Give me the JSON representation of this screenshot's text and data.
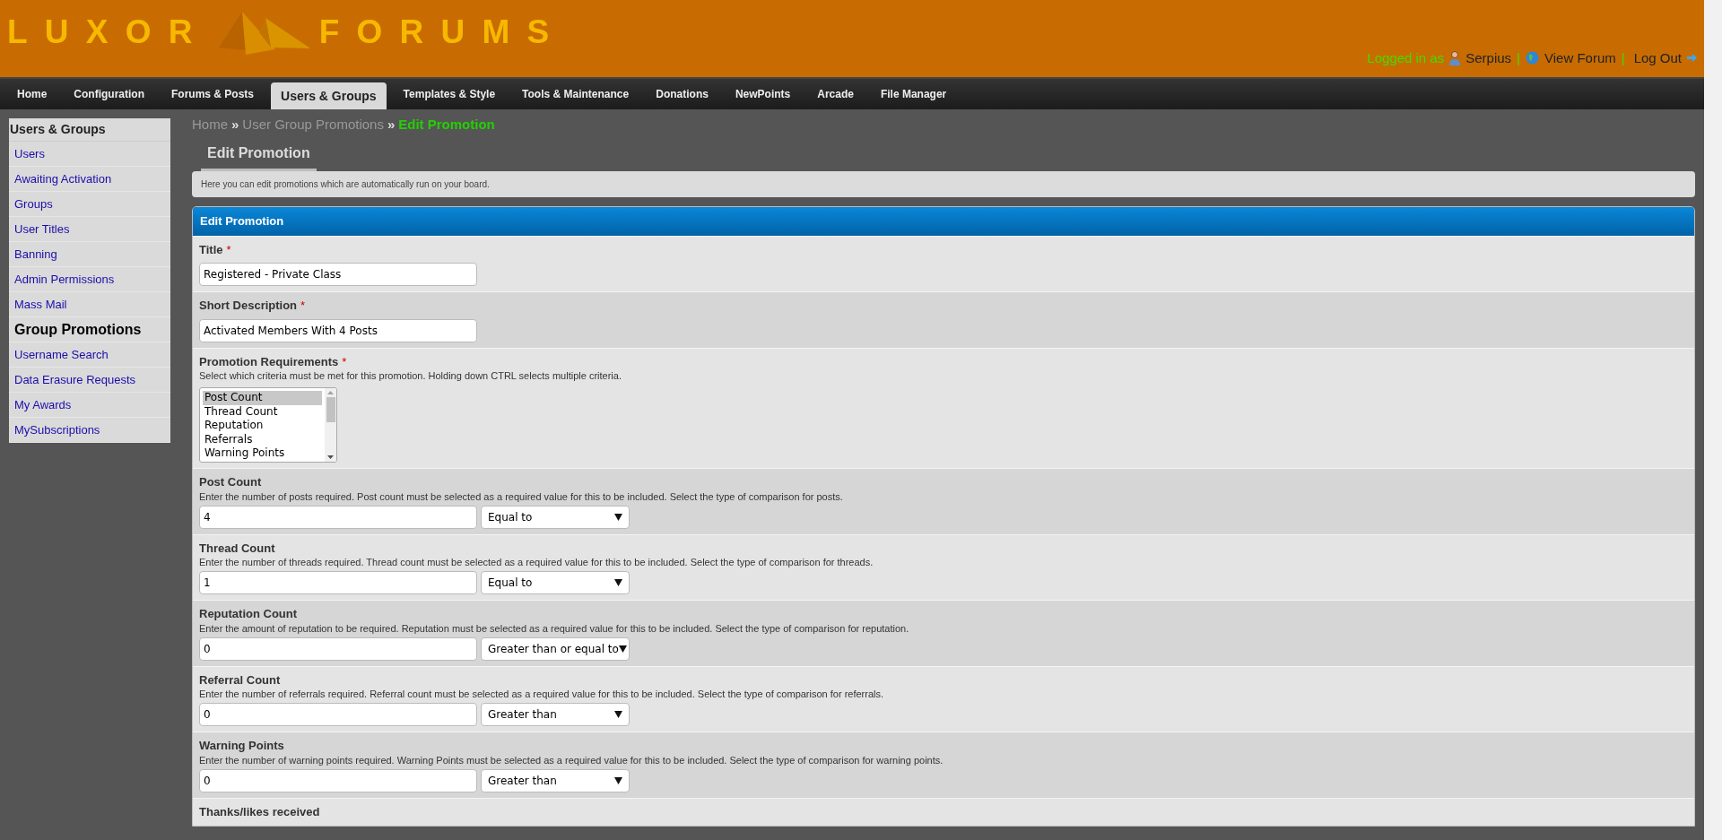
{
  "logo": {
    "left": "LUXOR",
    "right": "FORUMS"
  },
  "user_bar": {
    "logged_in_label": "Logged in as",
    "username": "Serpius",
    "view_forum": "View Forum",
    "log_out": "Log Out",
    "separator": "|"
  },
  "nav_tabs": [
    {
      "label": "Home",
      "selected": false
    },
    {
      "label": "Configuration",
      "selected": false
    },
    {
      "label": "Forums & Posts",
      "selected": false
    },
    {
      "label": "Users & Groups",
      "selected": true
    },
    {
      "label": "Templates & Style",
      "selected": false
    },
    {
      "label": "Tools & Maintenance",
      "selected": false
    },
    {
      "label": "Donations",
      "selected": false
    },
    {
      "label": "NewPoints",
      "selected": false
    },
    {
      "label": "Arcade",
      "selected": false
    },
    {
      "label": "File Manager",
      "selected": false
    }
  ],
  "sidebar": {
    "title": "Users & Groups",
    "items": [
      {
        "label": "Users",
        "selected": false
      },
      {
        "label": "Awaiting Activation",
        "selected": false
      },
      {
        "label": "Groups",
        "selected": false
      },
      {
        "label": "User Titles",
        "selected": false
      },
      {
        "label": "Banning",
        "selected": false
      },
      {
        "label": "Admin Permissions",
        "selected": false
      },
      {
        "label": "Mass Mail",
        "selected": false
      },
      {
        "label": "Group Promotions",
        "selected": true
      },
      {
        "label": "Username Search",
        "selected": false
      },
      {
        "label": "Data Erasure Requests",
        "selected": false
      },
      {
        "label": "My Awards",
        "selected": false
      },
      {
        "label": "MySubscriptions",
        "selected": false
      }
    ]
  },
  "breadcrumb": {
    "items": [
      "Home",
      "User Group Promotions",
      "Edit Promotion"
    ],
    "separator": "»"
  },
  "page_tab": "Edit Promotion",
  "page_description": "Here you can edit promotions which are automatically run on your board.",
  "form": {
    "title": "Edit Promotion",
    "required_mark": "*",
    "rows": [
      {
        "kind": "text",
        "label": "Title",
        "required": true,
        "value": "Registered - Private Class"
      },
      {
        "kind": "text",
        "label": "Short Description",
        "required": true,
        "value": "Activated Members With 4 Posts"
      },
      {
        "kind": "listbox",
        "label": "Promotion Requirements",
        "required": true,
        "description": "Select which criteria must be met for this promotion. Holding down CTRL selects multiple criteria.",
        "options": [
          {
            "label": "Post Count",
            "selected": true
          },
          {
            "label": "Thread Count",
            "selected": false
          },
          {
            "label": "Reputation",
            "selected": false
          },
          {
            "label": "Referrals",
            "selected": false
          },
          {
            "label": "Warning Points",
            "selected": false
          }
        ]
      },
      {
        "kind": "compare",
        "label": "Post Count",
        "required": false,
        "description": "Enter the number of posts required. Post count must be selected as a required value for this to be included. Select the type of comparison for posts.",
        "value": "4",
        "comparison": "Equal to"
      },
      {
        "kind": "compare",
        "label": "Thread Count",
        "required": false,
        "description": "Enter the number of threads required. Thread count must be selected as a required value for this to be included. Select the type of comparison for threads.",
        "value": "1",
        "comparison": "Equal to"
      },
      {
        "kind": "compare",
        "label": "Reputation Count",
        "required": false,
        "description": "Enter the amount of reputation to be required. Reputation must be selected as a required value for this to be included. Select the type of comparison for reputation.",
        "value": "0",
        "comparison": "Greater than or equal to"
      },
      {
        "kind": "compare",
        "label": "Referral Count",
        "required": false,
        "description": "Enter the number of referrals required. Referral count must be selected as a required value for this to be included. Select the type of comparison for referrals.",
        "value": "0",
        "comparison": "Greater than"
      },
      {
        "kind": "compare",
        "label": "Warning Points",
        "required": false,
        "description": "Enter the number of warning points required. Warning Points must be selected as a required value for this to be included. Select the type of comparison for warning points.",
        "value": "0",
        "comparison": "Greater than"
      },
      {
        "kind": "heading",
        "label": "Thanks/likes received",
        "required": false
      }
    ]
  }
}
